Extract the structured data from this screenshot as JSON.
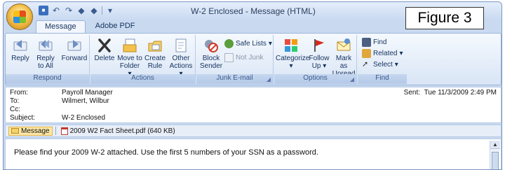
{
  "window": {
    "title": "W-2 Enclosed - Message (HTML)"
  },
  "figure_label": "Figure 3",
  "tabs": [
    {
      "label": "Message"
    },
    {
      "label": "Adobe PDF"
    }
  ],
  "ribbon": {
    "respond": {
      "label": "Respond",
      "reply": "Reply",
      "reply_all_1": "Reply",
      "reply_all_2": "to All",
      "forward": "Forward"
    },
    "actions": {
      "label": "Actions",
      "delete": "Delete",
      "move_1": "Move to",
      "move_2": "Folder",
      "create_1": "Create",
      "create_2": "Rule",
      "other_1": "Other",
      "other_2": "Actions"
    },
    "junk": {
      "label": "Junk E-mail",
      "safe_lists": "Safe Lists",
      "block_1": "Block",
      "block_2": "Sender",
      "not_junk": "Not Junk"
    },
    "options": {
      "label": "Options",
      "categorize": "Categorize",
      "follow_1": "Follow",
      "follow_2": "Up",
      "mark_1": "Mark as",
      "mark_2": "Unread"
    },
    "find": {
      "label": "Find",
      "find": "Find",
      "related": "Related",
      "select": "Select"
    }
  },
  "header": {
    "from_label": "From:",
    "from": "Payroll Manager",
    "to_label": "To:",
    "to": "Wilmert, Wilbur",
    "cc_label": "Cc:",
    "cc": "",
    "subject_label": "Subject:",
    "subject": "W-2 Enclosed",
    "sent_label": "Sent:",
    "sent": "Tue 11/3/2009 2:49 PM"
  },
  "attachments": {
    "message": "Message",
    "file": "2009 W2 Fact Sheet.pdf (640 KB)"
  },
  "body": {
    "text": "Please find your 2009 W-2 attached. Use the first 5 numbers of your SSN as a password."
  }
}
